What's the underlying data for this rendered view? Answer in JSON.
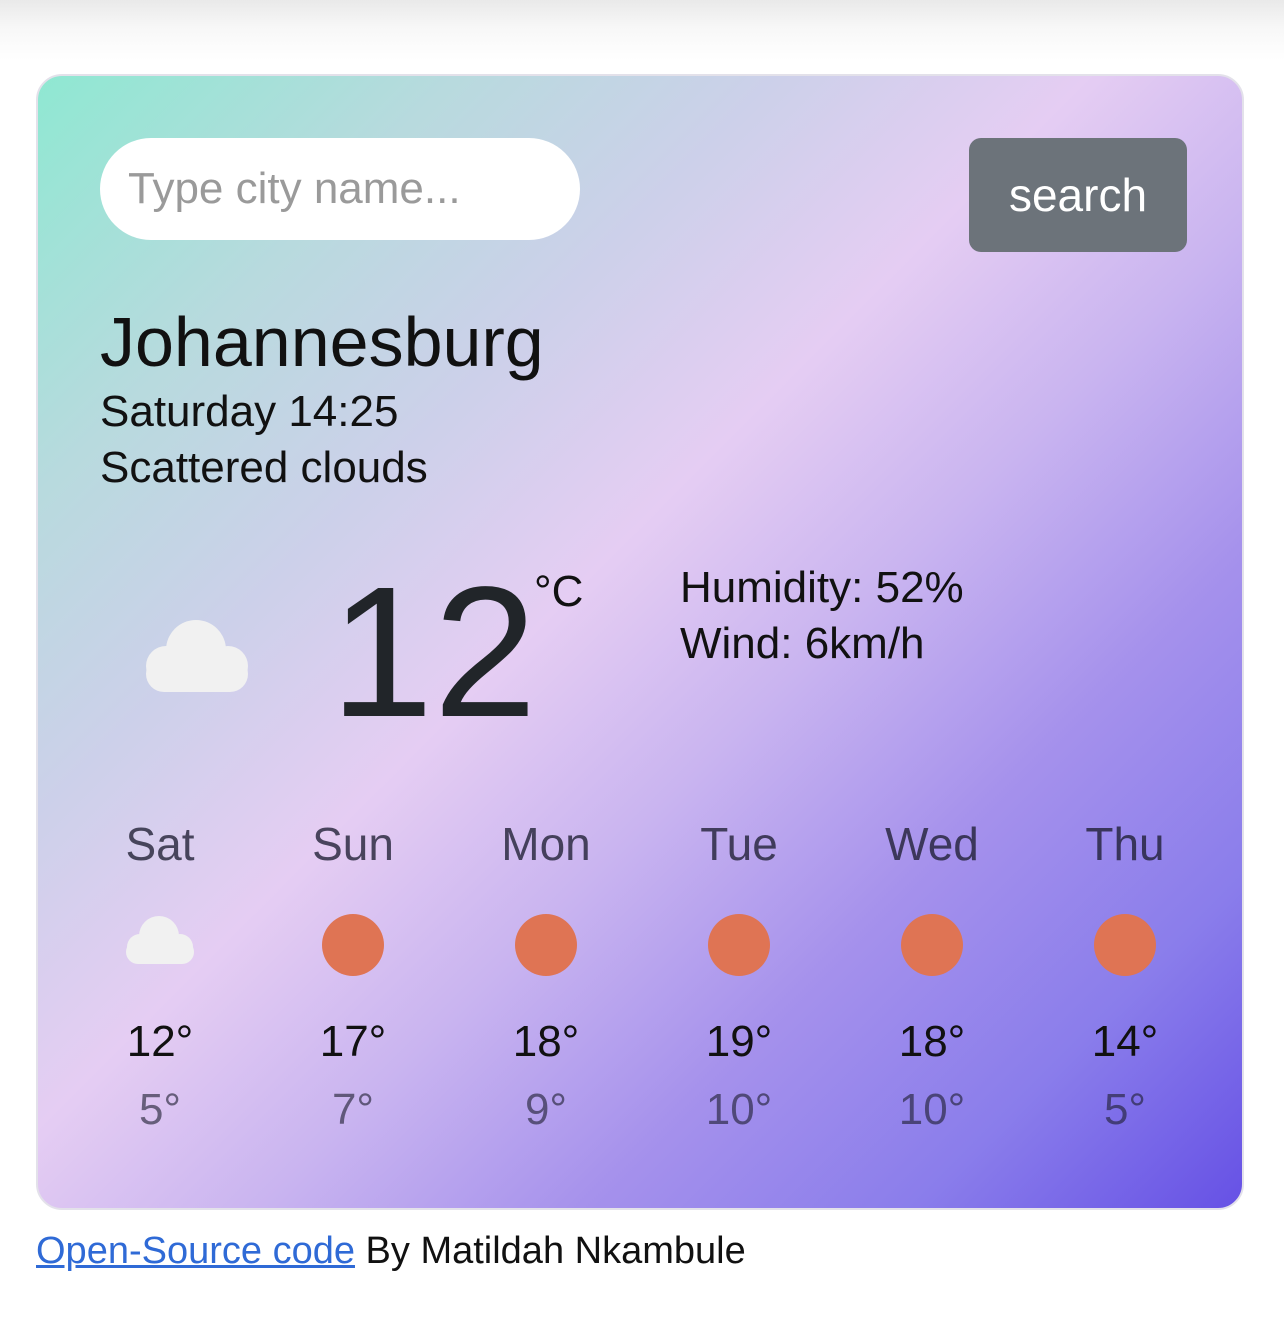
{
  "search": {
    "placeholder": "Type city name...",
    "button_label": "search"
  },
  "current": {
    "city": "Johannesburg",
    "datetime": "Saturday 14:25",
    "description": "Scattered clouds",
    "icon": "cloud-icon",
    "temperature": "12",
    "unit": "°C",
    "humidity_label": "Humidity: 52%",
    "wind_label": "Wind: 6km/h"
  },
  "forecast": [
    {
      "day": "Sat",
      "icon": "cloud-icon",
      "max": "12°",
      "min": "5°"
    },
    {
      "day": "Sun",
      "icon": "sun-icon",
      "max": "17°",
      "min": "7°"
    },
    {
      "day": "Mon",
      "icon": "sun-icon",
      "max": "18°",
      "min": "9°"
    },
    {
      "day": "Tue",
      "icon": "sun-icon",
      "max": "19°",
      "min": "10°"
    },
    {
      "day": "Wed",
      "icon": "sun-icon",
      "max": "18°",
      "min": "10°"
    },
    {
      "day": "Thu",
      "icon": "sun-icon",
      "max": "14°",
      "min": "5°"
    }
  ],
  "footer": {
    "link_text": "Open-Source code",
    "author_text": " By Matildah Nkambule"
  },
  "colors": {
    "search_button": "#6c737a",
    "sun": "#df7454",
    "cloud": "#f1f1f1",
    "link": "#2f6ad6"
  }
}
